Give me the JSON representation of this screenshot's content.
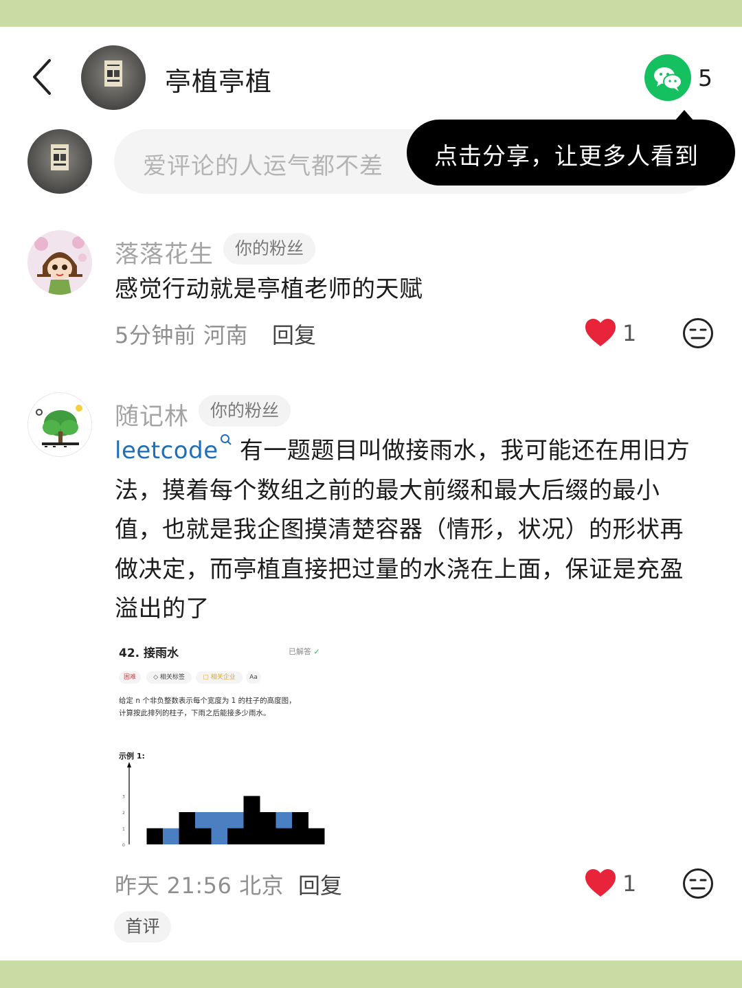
{
  "header": {
    "title": "亭植亭植",
    "share_count": "5"
  },
  "comment_box": {
    "placeholder": "爱评论的人运气都不差"
  },
  "share_tooltip": {
    "text": "点击分享，让更多人看到"
  },
  "comments": [
    {
      "username": "落落花生",
      "badge": "你的粉丝",
      "text": "感觉行动就是亭植老师的天赋",
      "meta": "5分钟前 河南",
      "reply_label": "回复",
      "likes": "1"
    },
    {
      "username": "随记林",
      "badge": "你的粉丝",
      "link_text": "leetcode",
      "text_line1": "有一题题目叫做接雨水，我可能还在用旧方",
      "text_line2": "法，摸着每个数组之前的最大前缀和最大后缀的最小",
      "text_line3": "值，也就是我企图摸清楚容器（情形，状况）的形状再",
      "text_line4": "做决定，而亭植直接把过量的水浇在上面，保证是充盈",
      "text_line5": "溢出的了",
      "meta": "昨天 21:56 北京",
      "reply_label": "回复",
      "likes": "1",
      "first_badge": "首评",
      "attachment": {
        "title": "42. 接雨水",
        "status": "已解答",
        "tags": [
          "困难",
          "相关标签",
          "相关企业",
          "Aa"
        ],
        "desc_line1": "给定 n 个非负整数表示每个宽度为 1 的柱子的高度图，",
        "desc_line2": "计算按此排列的柱子，下雨之后能接多少雨水。",
        "example_label": "示例 1:",
        "y_ticks": [
          "0",
          "1",
          "2",
          "3"
        ],
        "heights": [
          0,
          1,
          0,
          2,
          1,
          0,
          1,
          3,
          2,
          1,
          2,
          1
        ],
        "water": [
          0,
          0,
          1,
          0,
          1,
          2,
          1,
          0,
          0,
          1,
          0,
          0
        ],
        "bar_color": "#000000",
        "water_color": "#4a7fc1"
      }
    }
  ],
  "colors": {
    "band": "#c9dca4",
    "wechat_green": "#14c05f",
    "heart_red": "#e8243a"
  }
}
